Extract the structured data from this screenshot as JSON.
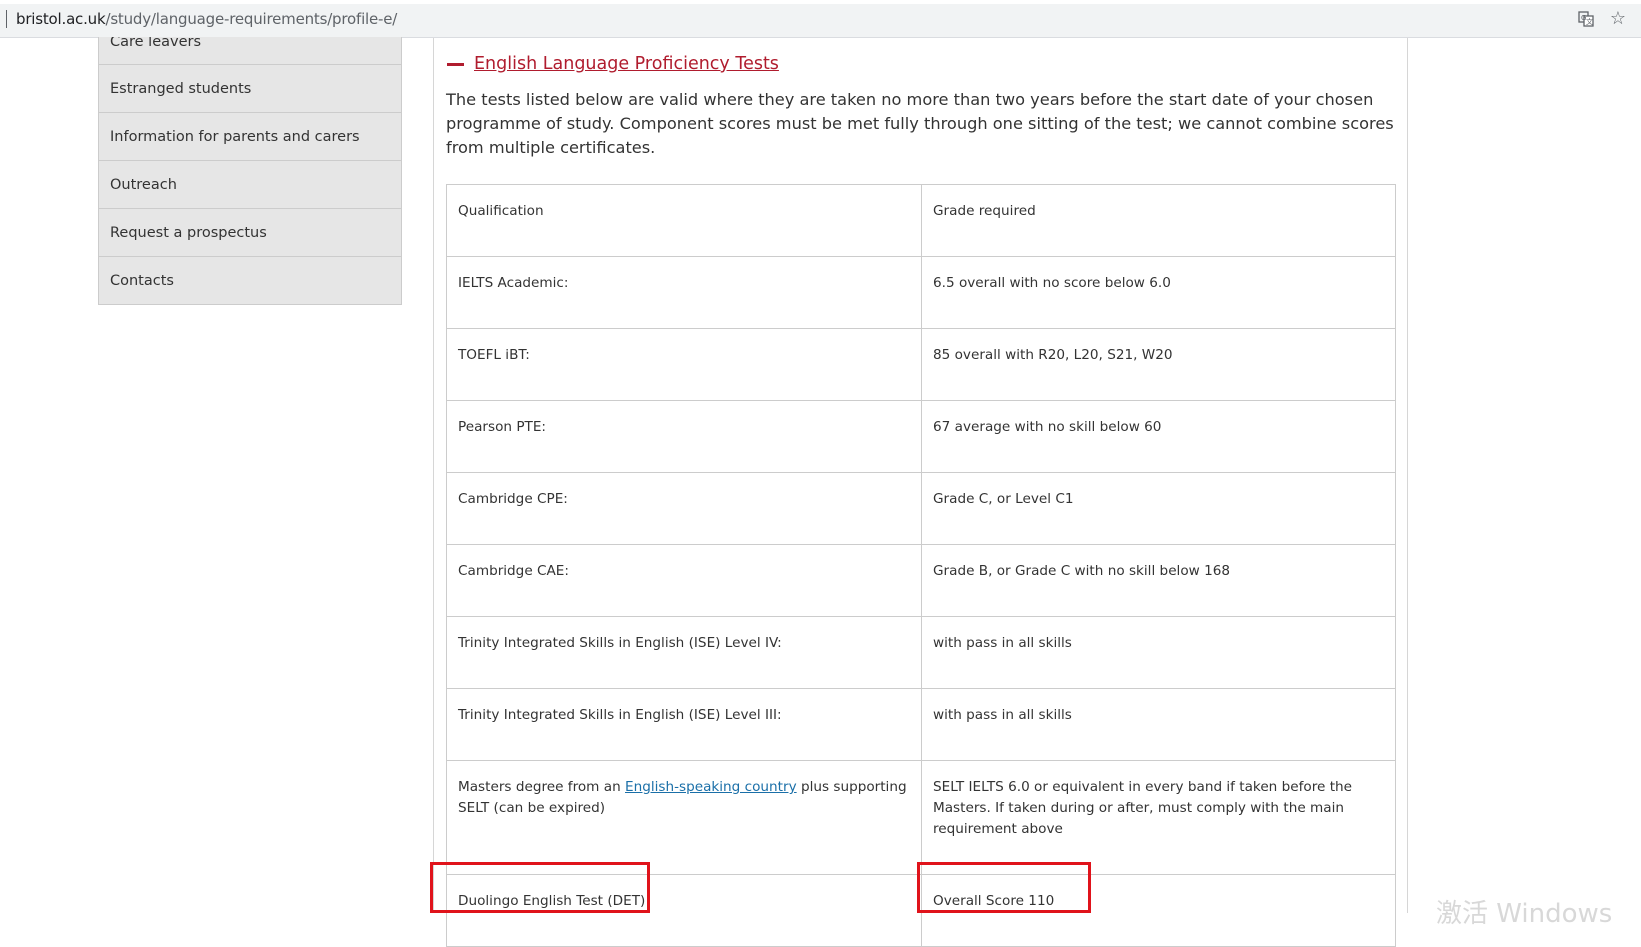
{
  "browser": {
    "url_host": "bristol.ac.uk",
    "url_path": "/study/language-requirements/profile-e/"
  },
  "sidebar": {
    "items": [
      {
        "label": "Care leavers"
      },
      {
        "label": "Estranged students"
      },
      {
        "label": "Information for parents and carers"
      },
      {
        "label": "Outreach"
      },
      {
        "label": "Request a prospectus"
      },
      {
        "label": "Contacts"
      }
    ]
  },
  "main": {
    "section_title": "English Language Proficiency Tests",
    "intro": "The tests listed below are valid where they are taken no more than two years before the start date of your chosen programme of study. Component scores must be met fully through one sitting of the test; we cannot combine scores from multiple certificates.",
    "table": {
      "headers": [
        "Qualification",
        "Grade required"
      ],
      "rows": [
        {
          "qualification": "IELTS Academic:",
          "grade": "6.5 overall with no score below 6.0"
        },
        {
          "qualification": "TOEFL iBT:",
          "grade": "85 overall with R20, L20, S21, W20"
        },
        {
          "qualification": "Pearson PTE:",
          "grade": "67 average with no skill below 60"
        },
        {
          "qualification": "Cambridge CPE:",
          "grade": "Grade C, or Level C1"
        },
        {
          "qualification": "Cambridge CAE:",
          "grade": "Grade B, or Grade C with no skill below 168"
        },
        {
          "qualification": "Trinity Integrated Skills in English (ISE) Level IV:",
          "grade": "with pass in all skills"
        },
        {
          "qualification": "Trinity Integrated Skills in English (ISE) Level III:",
          "grade": "with pass in all skills"
        }
      ],
      "masters_row": {
        "qualification_pre": "Masters degree from an ",
        "qualification_link": "English-speaking country",
        "qualification_post": " plus supporting SELT (can be expired)",
        "grade": "SELT IELTS 6.0 or equivalent in every band if taken before the Masters. If taken during or after, must comply with the main requirement above"
      },
      "duolingo_row": {
        "qualification": "Duolingo English Test (DET)",
        "grade": "Overall Score 110"
      }
    }
  },
  "overlay": {
    "watermark": "激活 Windows"
  },
  "colors": {
    "accent_red": "#b01c2e",
    "highlight_box": "#e0131b",
    "link_blue": "#1a6fa8",
    "sidebar_bg": "#e6e6e6"
  },
  "icons": {
    "address_bar": [
      "translate-icon",
      "star-icon"
    ],
    "accordion": "collapse-dash-icon"
  }
}
